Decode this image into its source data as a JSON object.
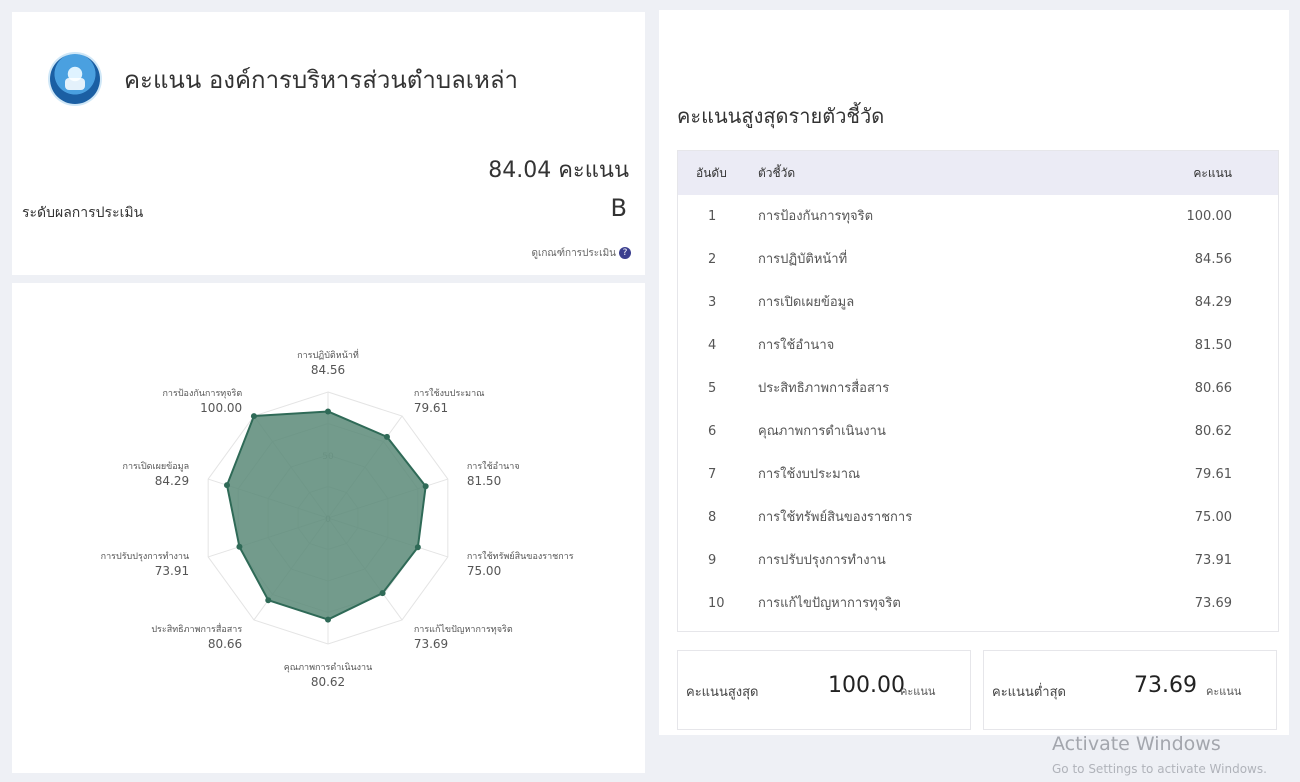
{
  "header": {
    "org_title": "คะแนน องค์การบริหารส่วนตำบลเหล่า",
    "total_score": "84.04 คะแนน",
    "level_label": "ระดับผลการประเมิน",
    "grade": "B",
    "criteria_link": "ดูเกณฑ์การประเมิน",
    "help_icon": "question-circle-icon"
  },
  "chart_data": {
    "type": "radar",
    "range": [
      0,
      100
    ],
    "grid_labels": [
      "0",
      "50"
    ],
    "fill_color": "#5a8a78",
    "axes": [
      {
        "label": "การปฏิบัติหน้าที่",
        "value": 84.56,
        "value_text": "84.56"
      },
      {
        "label": "การใช้งบประมาณ",
        "value": 79.61,
        "value_text": "79.61"
      },
      {
        "label": "การใช้อำนาจ",
        "value": 81.5,
        "value_text": "81.50"
      },
      {
        "label": "การใช้ทรัพย์สินของราชการ",
        "value": 75.0,
        "value_text": "75.00"
      },
      {
        "label": "การแก้ไขปัญหาการทุจริต",
        "value": 73.69,
        "value_text": "73.69"
      },
      {
        "label": "คุณภาพการดำเนินงาน",
        "value": 80.62,
        "value_text": "80.62"
      },
      {
        "label": "ประสิทธิภาพการสื่อสาร",
        "value": 80.66,
        "value_text": "80.66"
      },
      {
        "label": "การปรับปรุงการทำงาน",
        "value": 73.91,
        "value_text": "73.91"
      },
      {
        "label": "การเปิดเผยข้อมูล",
        "value": 84.29,
        "value_text": "84.29"
      },
      {
        "label": "การป้องกันการทุจริต",
        "value": 100.0,
        "value_text": "100.00"
      }
    ]
  },
  "ranking": {
    "title": "คะแนนสูงสุดรายตัวชี้วัด",
    "headers": {
      "rank": "อันดับ",
      "indicator": "ตัวชี้วัด",
      "score": "คะแนน"
    },
    "rows": [
      {
        "rank": "1",
        "name": "การป้องกันการทุจริต",
        "score": "100.00"
      },
      {
        "rank": "2",
        "name": "การปฏิบัติหน้าที่",
        "score": "84.56"
      },
      {
        "rank": "3",
        "name": "การเปิดเผยข้อมูล",
        "score": "84.29"
      },
      {
        "rank": "4",
        "name": "การใช้อำนาจ",
        "score": "81.50"
      },
      {
        "rank": "5",
        "name": "ประสิทธิภาพการสื่อสาร",
        "score": "80.66"
      },
      {
        "rank": "6",
        "name": "คุณภาพการดำเนินงาน",
        "score": "80.62"
      },
      {
        "rank": "7",
        "name": "การใช้งบประมาณ",
        "score": "79.61"
      },
      {
        "rank": "8",
        "name": "การใช้ทรัพย์สินของราชการ",
        "score": "75.00"
      },
      {
        "rank": "9",
        "name": "การปรับปรุงการทำงาน",
        "score": "73.91"
      },
      {
        "rank": "10",
        "name": "การแก้ไขปัญหาการทุจริต",
        "score": "73.69"
      }
    ]
  },
  "stats": {
    "high": {
      "label": "คะแนนสูงสุด",
      "value": "100.00",
      "unit": "คะแนน"
    },
    "low": {
      "label": "คะแนนต่ำสุด",
      "value": "73.69",
      "unit": "คะแนน"
    }
  },
  "watermark": {
    "title": "Activate Windows",
    "subtitle": "Go to Settings to activate Windows."
  }
}
